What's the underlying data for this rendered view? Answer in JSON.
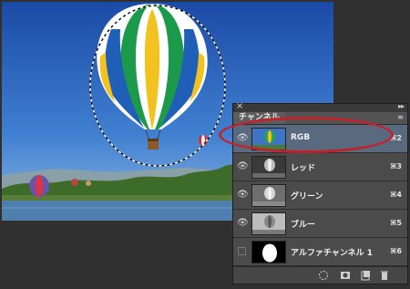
{
  "panel": {
    "close_icon": "×",
    "collapse_icon": "▸▸",
    "tab_label": "チャンネル",
    "menu_icon": "≡",
    "channels": [
      {
        "name": "RGB",
        "shortcut": "⌘2",
        "visible": true,
        "selected": true
      },
      {
        "name": "レッド",
        "shortcut": "⌘3",
        "visible": true,
        "selected": false
      },
      {
        "name": "グリーン",
        "shortcut": "⌘4",
        "visible": true,
        "selected": false
      },
      {
        "name": "ブルー",
        "shortcut": "⌘5",
        "visible": true,
        "selected": false
      },
      {
        "name": "アルファチャンネル 1",
        "shortcut": "⌘6",
        "visible": false,
        "selected": false
      }
    ],
    "bottom_icons": [
      "load-selection-icon",
      "save-selection-icon",
      "new-channel-icon",
      "trash-icon"
    ]
  },
  "colors": {
    "highlight": "#c0232e",
    "selected_row": "#5a6a7e",
    "panel_bg": "#4a4a4a"
  }
}
